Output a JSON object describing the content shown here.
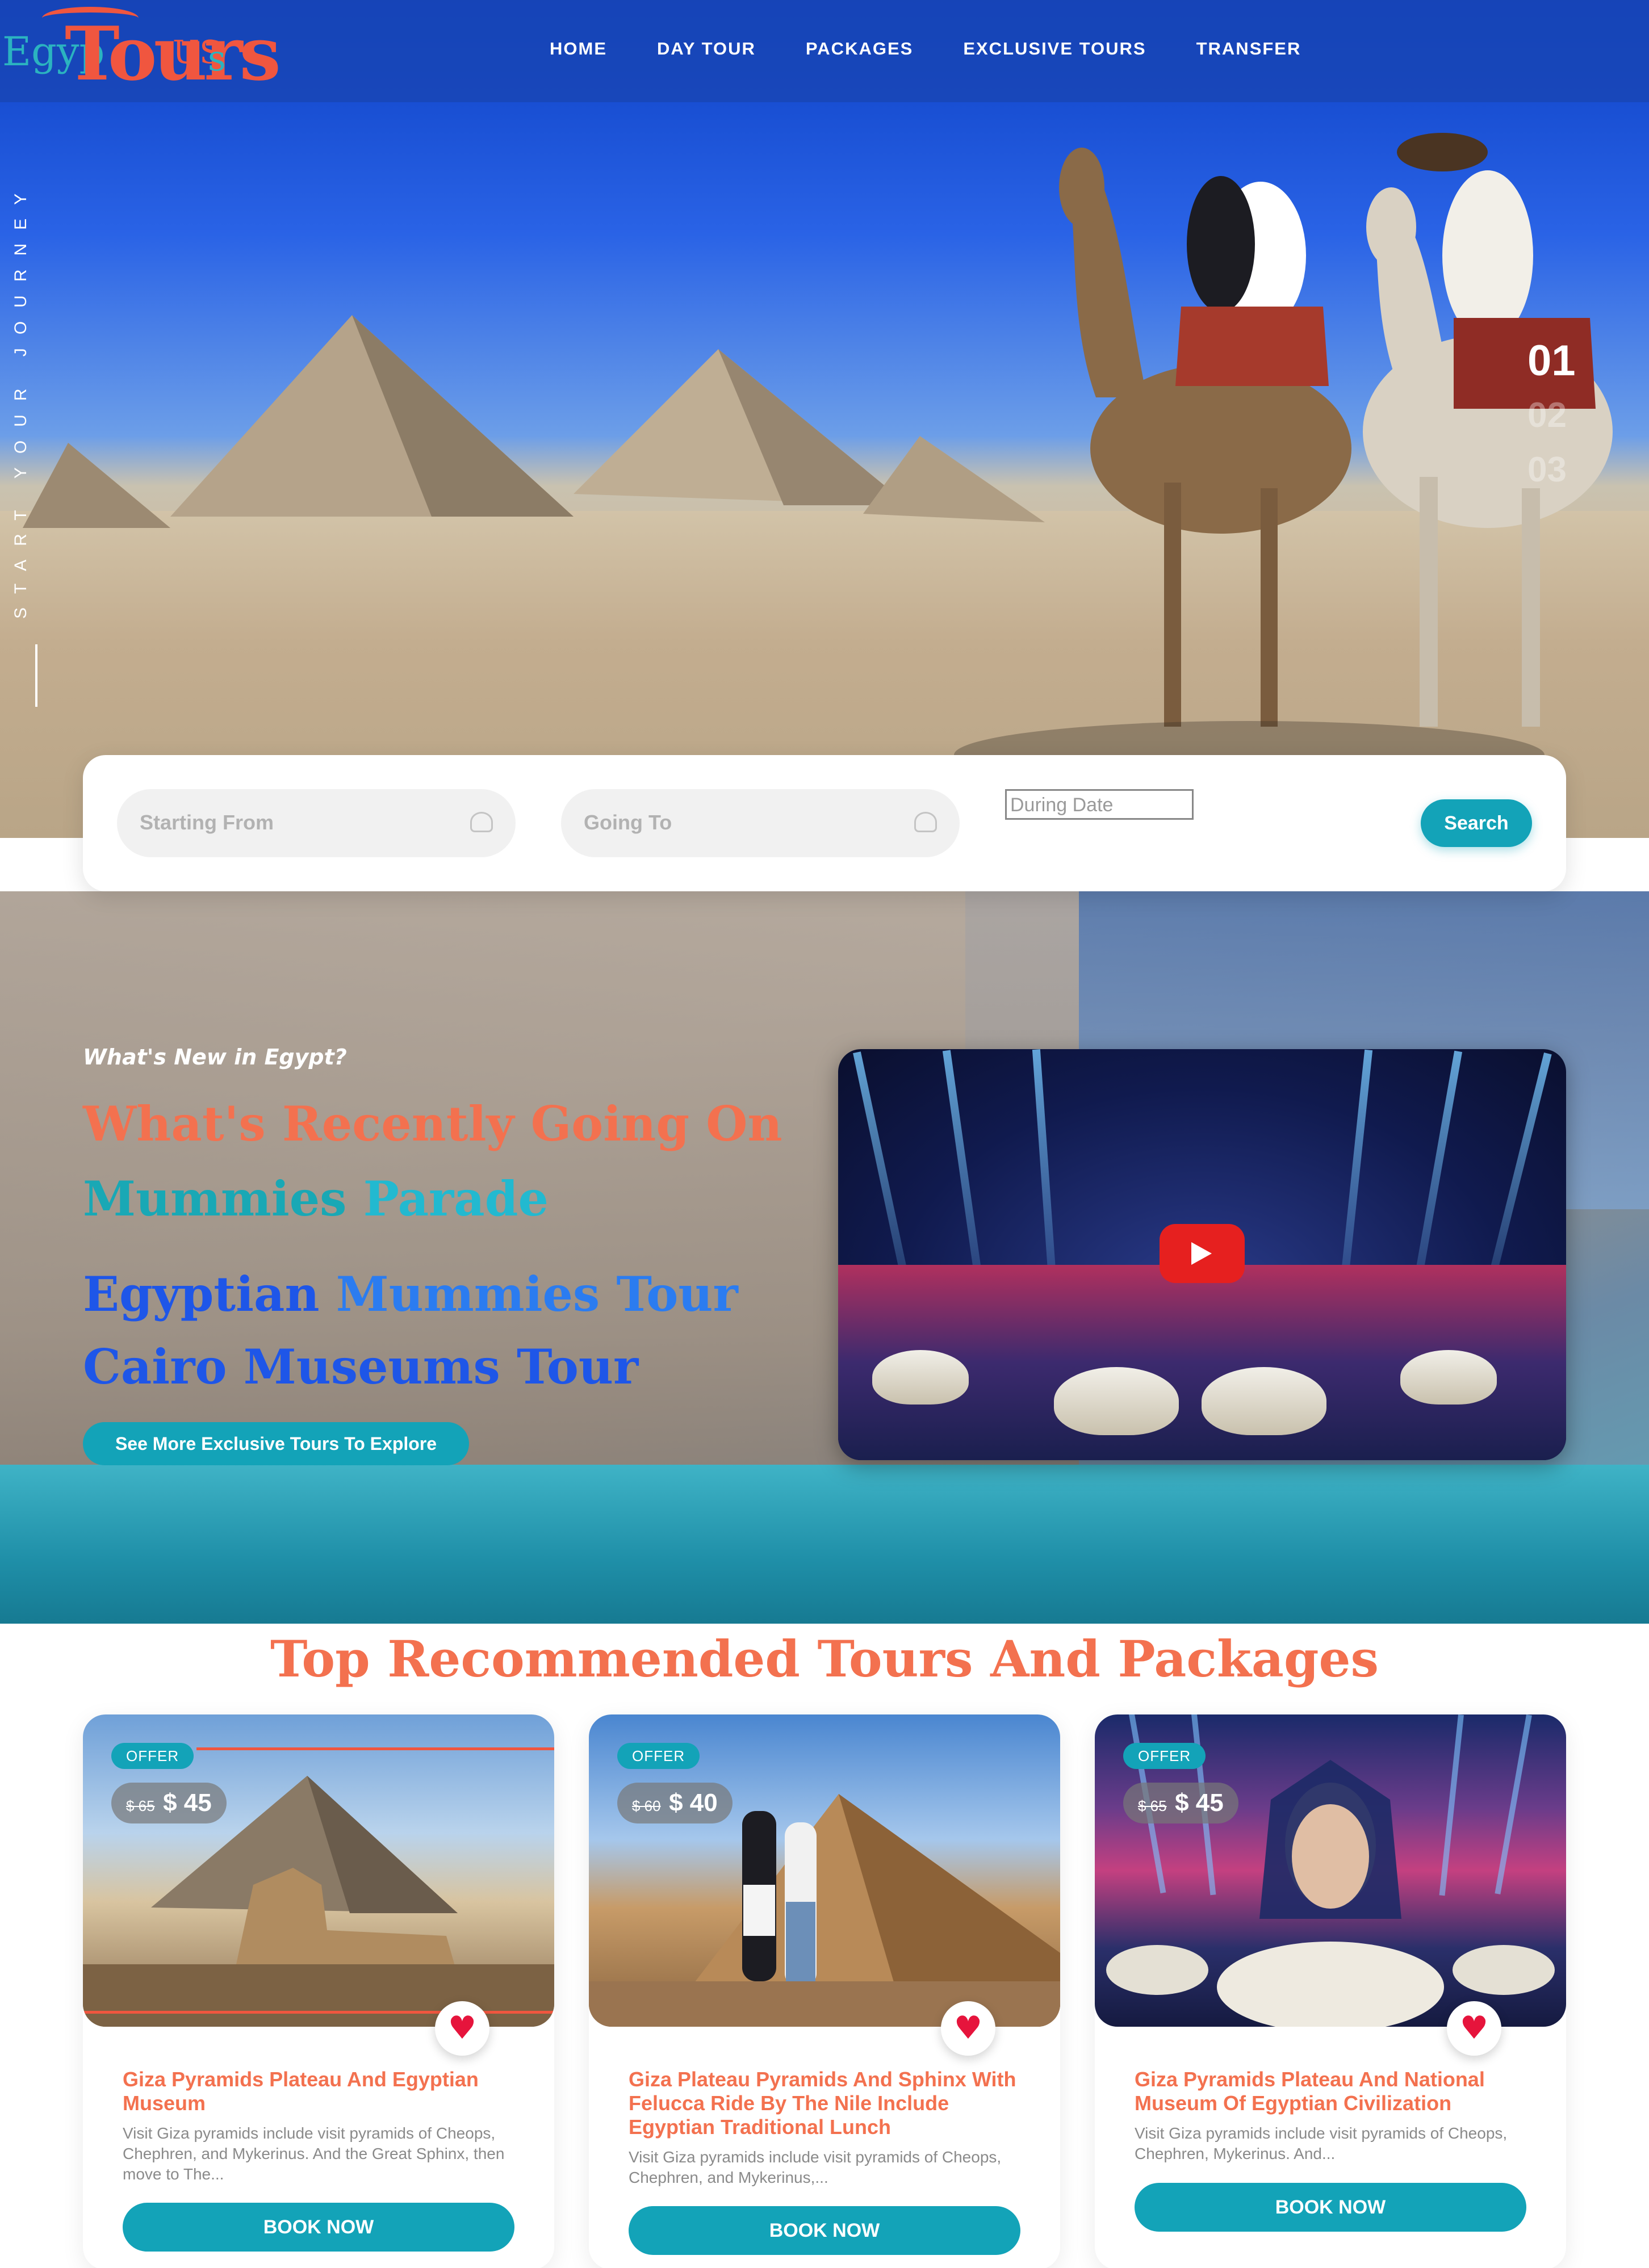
{
  "brand": {
    "logo_egypt": "Egyp",
    "logo_tours": "Tours",
    "logo_us": "US",
    "logo_s": "s",
    "primary_color": "#13a3b8",
    "accent_color": "#f3714f"
  },
  "nav": {
    "items": [
      "HOME",
      "DAY TOUR",
      "PACKAGES",
      "EXCLUSIVE TOURS",
      "TRANSFER"
    ]
  },
  "hero": {
    "vertical_tagline": "START YOUR JOURNEY",
    "slides": [
      "01",
      "02",
      "03"
    ],
    "active_slide": 0
  },
  "search": {
    "from_placeholder": "Starting From",
    "to_placeholder": "Going To",
    "date_placeholder": "During Date",
    "button_label": "Search"
  },
  "news": {
    "tag": "What's New in Egypt?",
    "heading": "What's Recently Going On",
    "line2_a": "Mummies",
    "line2_b": "Parade",
    "line3_a": "Egyptian",
    "line3_b": "Mummies Tour",
    "line4": "Cairo Museums Tour",
    "button_label": "See More Exclusive Tours To Explore"
  },
  "recommended": {
    "title": "Top Recommended Tours And Packages",
    "cards": [
      {
        "badge": "OFFER",
        "old_price": "$ 65",
        "new_price": "$ 45",
        "title": "Giza Pyramids Plateau And Egyptian Museum",
        "description": "Visit Giza pyramids include visit pyramids of Cheops, Chephren, and Mykerinus. And the Great Sphinx, then move to The...",
        "button": "BOOK NOW"
      },
      {
        "badge": "OFFER",
        "old_price": "$ 60",
        "new_price": "$ 40",
        "title": "Giza Plateau Pyramids And Sphinx With Felucca Ride By The Nile Include Egyptian Traditional Lunch",
        "description": "Visit Giza pyramids include visit pyramids of Cheops, Chephren, and Mykerinus,...",
        "button": "BOOK NOW"
      },
      {
        "badge": "OFFER",
        "old_price": "$ 65",
        "new_price": "$ 45",
        "title": "Giza Pyramids Plateau And National Museum Of Egyptian Civilization",
        "description": "Visit Giza pyramids include visit pyramids of Cheops, Chephren, Mykerinus. And...",
        "button": "BOOK NOW"
      }
    ]
  }
}
